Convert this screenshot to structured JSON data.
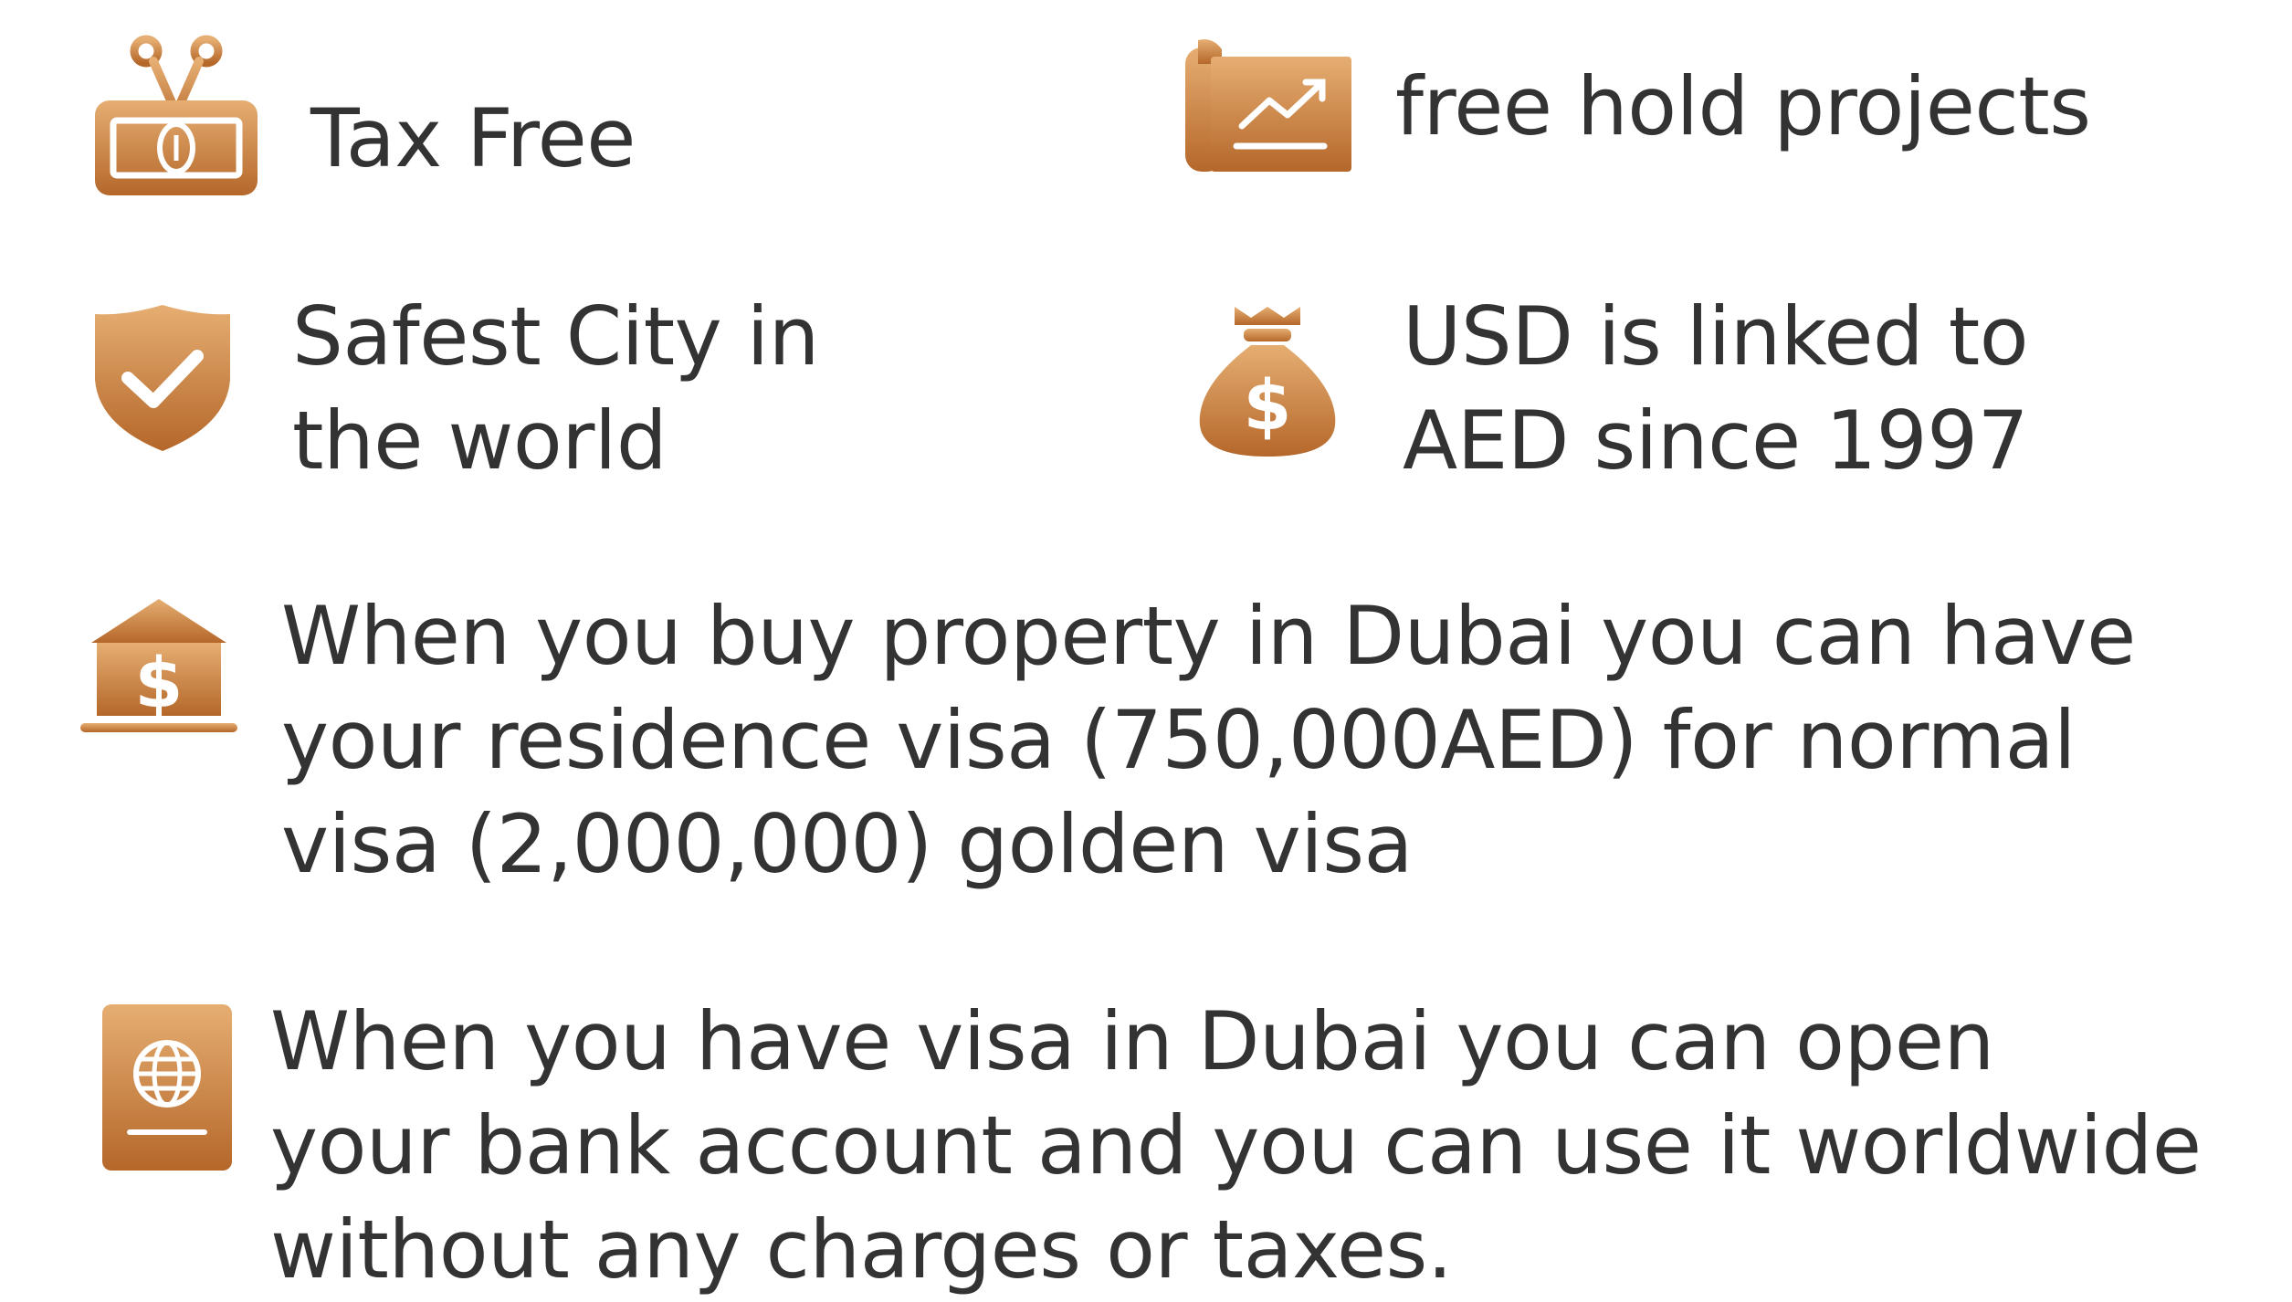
{
  "accent_colors": {
    "gold_light": "#E3A86A",
    "gold_dark": "#B96A2A",
    "text": "#333333"
  },
  "features": [
    {
      "icon": "tax-cut-scissors-icon",
      "lines": [
        "Tax Free"
      ]
    },
    {
      "icon": "growth-chart-scroll-icon",
      "lines": [
        "free hold projects"
      ]
    },
    {
      "icon": "shield-check-icon",
      "lines": [
        "Safest City in",
        "the world"
      ]
    },
    {
      "icon": "money-bag-dollar-icon",
      "lines": [
        "USD is linked to",
        "AED since 1997"
      ]
    },
    {
      "icon": "bank-dollar-icon",
      "lines": [
        "When you buy property in Dubai you can have",
        "your residence visa (750,000AED) for normal",
        "visa (2,000,000) golden visa"
      ]
    },
    {
      "icon": "passport-globe-icon",
      "lines": [
        "When you have visa in Dubai you can open",
        "your bank account and you can use it worldwide",
        "without any charges or taxes."
      ]
    }
  ]
}
